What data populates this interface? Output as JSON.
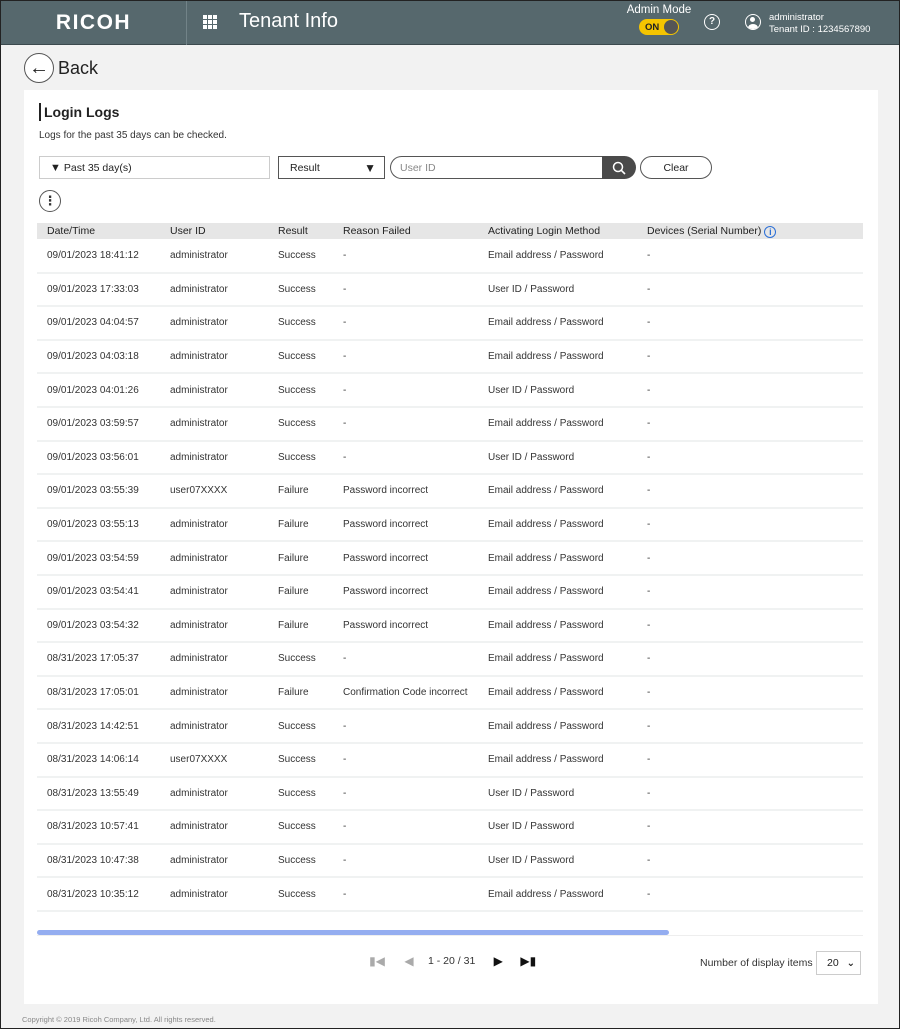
{
  "header": {
    "logo": "RICOH",
    "app_title": "Tenant Info",
    "admin_mode_label": "Admin Mode",
    "admin_mode_state": "ON",
    "help_icon": "question-circle-icon",
    "user_name": "administrator",
    "tenant_id": "Tenant ID : 1234567890"
  },
  "nav": {
    "back_label": "Back"
  },
  "panel": {
    "title": "Login Logs",
    "description": "Logs for the past 35 days can be checked.",
    "period_filter": "Past 35 day(s)",
    "result_select": "Result",
    "user_id_placeholder": "User ID",
    "user_id_value": "",
    "clear_label": "Clear",
    "more_icon": "vertical-ellipsis-icon"
  },
  "table": {
    "columns": [
      "Date/Time",
      "User ID",
      "Result",
      "Reason Failed",
      "Activating Login Method",
      "Devices (Serial Number)"
    ],
    "rows": [
      [
        "09/01/2023 18:41:12",
        "administrator",
        "Success",
        "-",
        "Email address / Password",
        "-"
      ],
      [
        "09/01/2023 17:33:03",
        "administrator",
        "Success",
        "-",
        "User ID / Password",
        "-"
      ],
      [
        "09/01/2023 04:04:57",
        "administrator",
        "Success",
        "-",
        "Email address / Password",
        "-"
      ],
      [
        "09/01/2023 04:03:18",
        "administrator",
        "Success",
        "-",
        "Email address / Password",
        "-"
      ],
      [
        "09/01/2023 04:01:26",
        "administrator",
        "Success",
        "-",
        "User ID / Password",
        "-"
      ],
      [
        "09/01/2023 03:59:57",
        "administrator",
        "Success",
        "-",
        "Email address / Password",
        "-"
      ],
      [
        "09/01/2023 03:56:01",
        "administrator",
        "Success",
        "-",
        "User ID / Password",
        "-"
      ],
      [
        "09/01/2023 03:55:39",
        "user07XXXX",
        "Failure",
        "Password incorrect",
        "Email address / Password",
        "-"
      ],
      [
        "09/01/2023 03:55:13",
        "administrator",
        "Failure",
        "Password incorrect",
        "Email address / Password",
        "-"
      ],
      [
        "09/01/2023 03:54:59",
        "administrator",
        "Failure",
        "Password incorrect",
        "Email address / Password",
        "-"
      ],
      [
        "09/01/2023 03:54:41",
        "administrator",
        "Failure",
        "Password incorrect",
        "Email address / Password",
        "-"
      ],
      [
        "09/01/2023 03:54:32",
        "administrator",
        "Failure",
        "Password incorrect",
        "Email address / Password",
        "-"
      ],
      [
        "08/31/2023 17:05:37",
        "administrator",
        "Success",
        "-",
        "Email address / Password",
        "-"
      ],
      [
        "08/31/2023 17:05:01",
        "administrator",
        "Failure",
        "Confirmation Code incorrect",
        "Email address / Password",
        "-"
      ],
      [
        "08/31/2023 14:42:51",
        "administrator",
        "Success",
        "-",
        "Email address / Password",
        "-"
      ],
      [
        "08/31/2023 14:06:14",
        "user07XXXX",
        "Success",
        "-",
        "Email address / Password",
        "-"
      ],
      [
        "08/31/2023 13:55:49",
        "administrator",
        "Success",
        "-",
        "User ID / Password",
        "-"
      ],
      [
        "08/31/2023 10:57:41",
        "administrator",
        "Success",
        "-",
        "User ID / Password",
        "-"
      ],
      [
        "08/31/2023 10:47:38",
        "administrator",
        "Success",
        "-",
        "User ID / Password",
        "-"
      ],
      [
        "08/31/2023 10:35:12",
        "administrator",
        "Success",
        "-",
        "Email address / Password",
        "-"
      ]
    ]
  },
  "pagination": {
    "range_text": "1 - 20 / 31",
    "per_page_label": "Number of display items",
    "per_page_value": "20"
  },
  "footer": {
    "copyright": "Copyright © 2019 Ricoh Company, Ltd. All rights reserved."
  },
  "colors": {
    "header_bg": "#56686d",
    "toggle_on": "#f5c400",
    "info_icon": "#2b6fd6",
    "scrollbar": "#94adf0"
  }
}
